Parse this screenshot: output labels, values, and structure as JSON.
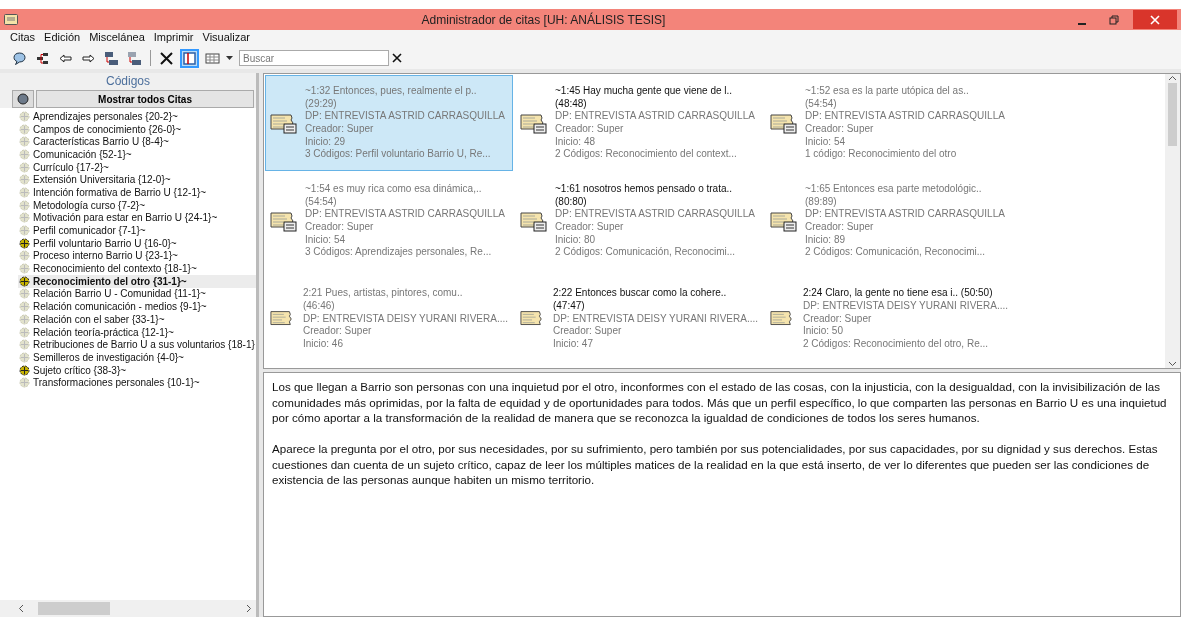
{
  "window": {
    "title": "Administrador de citas [UH: ANÁLISIS TESIS]"
  },
  "menu": [
    "Citas",
    "Edición",
    "Miscelánea",
    "Imprimir",
    "Visualizar"
  ],
  "toolbar": [
    {
      "kind": "bubble",
      "selected": false
    },
    {
      "kind": "tree",
      "selected": false
    },
    {
      "kind": "back",
      "selected": false
    },
    {
      "kind": "forward",
      "selected": false
    },
    {
      "kind": "window",
      "selected": false
    },
    {
      "kind": "window-off",
      "selected": false
    },
    {
      "kind": "separator"
    },
    {
      "kind": "delete",
      "selected": false
    },
    {
      "kind": "panel",
      "selected": true
    },
    {
      "kind": "grid",
      "selected": false
    }
  ],
  "search": {
    "placeholder": "Buscar"
  },
  "codes_panel": {
    "title": "Códigos",
    "show_all_button": "Mostrar todos Citas",
    "items": [
      {
        "label": "Aprendizajes personales {20-2}~",
        "marked": false,
        "selected": false
      },
      {
        "label": "Campos de conocimiento {26-0}~",
        "marked": false,
        "selected": false
      },
      {
        "label": "Características Barrio U {8-4}~",
        "marked": false,
        "selected": false
      },
      {
        "label": "Comunicación {52-1}~",
        "marked": false,
        "selected": false
      },
      {
        "label": "Currículo {17-2}~",
        "marked": false,
        "selected": false
      },
      {
        "label": "Extensión Universitaria {12-0}~",
        "marked": false,
        "selected": false
      },
      {
        "label": "Intención formativa de Barrio U {12-1}~",
        "marked": false,
        "selected": false
      },
      {
        "label": "Metodología curso {7-2}~",
        "marked": false,
        "selected": false
      },
      {
        "label": "Motivación para estar en Barrio U {24-1}~",
        "marked": false,
        "selected": false
      },
      {
        "label": "Perfil comunicador {7-1}~",
        "marked": false,
        "selected": false
      },
      {
        "label": "Perfil voluntario Barrio U {16-0}~",
        "marked": true,
        "selected": false
      },
      {
        "label": "Proceso interno Barrio U {23-1}~",
        "marked": false,
        "selected": false
      },
      {
        "label": "Reconocimiento del contexto {18-1}~",
        "marked": false,
        "selected": false
      },
      {
        "label": "Reconocimiento del otro {31-1}~",
        "marked": true,
        "selected": true
      },
      {
        "label": "Relación Barrio U - Comunidad {11-1}~",
        "marked": false,
        "selected": false
      },
      {
        "label": "Relación comunicación - medios {9-1}~",
        "marked": false,
        "selected": false
      },
      {
        "label": "Relación con el saber {33-1}~",
        "marked": false,
        "selected": false
      },
      {
        "label": "Relación teoría-práctica {12-1}~",
        "marked": false,
        "selected": false
      },
      {
        "label": "Retribuciones de Barrio U a sus voluntarios {18-1}",
        "marked": false,
        "selected": false
      },
      {
        "label": "Semilleros de investigación {4-0}~",
        "marked": false,
        "selected": false
      },
      {
        "label": "Sujeto crítico {38-3}~",
        "marked": true,
        "selected": false
      },
      {
        "label": "Transformaciones personales {10-1}~",
        "marked": false,
        "selected": false
      }
    ]
  },
  "quotes": [
    {
      "title": "~1:32 Entonces, pues, realmente el p..",
      "position": "(29:29)",
      "document": "DP: ENTREVISTA ASTRID CARRASQUILLA",
      "creator": "Creador: Super",
      "start": "Inicio: 29",
      "codes": "3 Códigos: Perfil voluntario Barrio U, Re...",
      "emphasized": false,
      "commented": true,
      "selected": true
    },
    {
      "title": "~1:45 Hay mucha gente que viene de l..",
      "position": "(48:48)",
      "document": "DP: ENTREVISTA ASTRID CARRASQUILLA",
      "creator": "Creador: Super",
      "start": "Inicio: 48",
      "codes": "2 Códigos: Reconocimiento del context...",
      "emphasized": true,
      "commented": true,
      "selected": false
    },
    {
      "title": "~1:52 esa es la parte utópica del as..",
      "position": "(54:54)",
      "document": "DP: ENTREVISTA ASTRID CARRASQUILLA",
      "creator": "Creador: Super",
      "start": "Inicio: 54",
      "codes": "1 código: Reconocimiento del otro",
      "emphasized": false,
      "commented": true,
      "selected": false
    },
    {
      "title": "~1:54 es muy rica como esa dinámica,..",
      "position": "(54:54)",
      "document": "DP: ENTREVISTA ASTRID CARRASQUILLA",
      "creator": "Creador: Super",
      "start": "Inicio: 54",
      "codes": "3 Códigos: Aprendizajes personales, Re...",
      "emphasized": false,
      "commented": true,
      "selected": false
    },
    {
      "title": "~1:61 nosotros hemos pensado o trata..",
      "position": "(80:80)",
      "document": "DP: ENTREVISTA ASTRID CARRASQUILLA",
      "creator": "Creador: Super",
      "start": "Inicio: 80",
      "codes": "2 Códigos: Comunicación, Reconocimi...",
      "emphasized": true,
      "commented": true,
      "selected": false
    },
    {
      "title": "~1:65 Entonces esa parte metodológic..",
      "position": "(89:89)",
      "document": "DP: ENTREVISTA ASTRID CARRASQUILLA",
      "creator": "Creador: Super",
      "start": "Inicio: 89",
      "codes": "2 Códigos: Comunicación, Reconocimi...",
      "emphasized": false,
      "commented": true,
      "selected": false
    },
    {
      "title": "2:21 Pues, artistas, pintores, comu..",
      "position": "(46:46)",
      "document": "DP: ENTREVISTA DEISY YURANI RIVERA....",
      "creator": "Creador: Super",
      "start": "Inicio: 46",
      "emphasized": false,
      "commented": false,
      "selected": false
    },
    {
      "title": "2:22 Entonces buscar como la cohere..",
      "position": "(47:47)",
      "document": "DP: ENTREVISTA DEISY YURANI RIVERA....",
      "creator": "Creador: Super",
      "start": "Inicio: 47",
      "emphasized": true,
      "commented": false,
      "selected": false
    },
    {
      "title": "2:24 Claro, la gente no tiene esa i.. (50:50)",
      "document": "DP: ENTREVISTA DEISY YURANI RIVERA....",
      "creator": "Creador: Super",
      "start": "Inicio: 50",
      "codes": "2 Códigos: Reconocimiento del otro, Re...",
      "emphasized": true,
      "commented": false,
      "selected": false
    }
  ],
  "text": {
    "paragraphs": [
      "Los que llegan a Barrio son personas con una inquietud por el otro, inconformes con el estado de las cosas, con la injusticia, con la desigualdad, con la invisibilización de las comunidades más oprimidas, por la falta de equidad y de oportunidades para todos. Más que un perfil específico, lo que comparten las personas en Barrio U es una inquietud por cómo aportar a la transformación de la realidad de manera que se reconozca la igualdad de condiciones de todos los seres humanos.",
      "Aparece la pregunta por el otro, por sus necesidades, por su sufrimiento, pero también por sus potencialidades, por sus capacidades, por su dignidad y sus derechos.  Estas cuestiones dan cuenta de un sujeto crítico, capaz de leer los múltiples matices de la realidad en la que está inserto, de ver lo diferentes que pueden ser las condiciones de existencia de las personas aunque habiten un mismo territorio."
    ]
  }
}
